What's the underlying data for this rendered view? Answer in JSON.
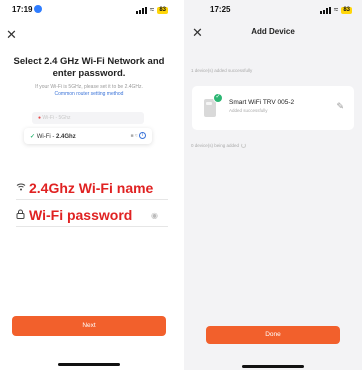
{
  "left_screen": {
    "status_bar": {
      "time": "17:19",
      "battery": "83"
    },
    "heading": "Select 2.4 GHz Wi-Fi Network and enter password.",
    "hint": "If your Wi-Fi is 5GHz, please set it to be 2.4GHz.",
    "hint_link": "Common router setting method",
    "illustration": {
      "row_5g": "Wi-Fi - 5Ghz",
      "row_24g_prefix": "Wi-Fi - ",
      "row_24g_band": "2.4Ghz"
    },
    "wifi_name_field": {
      "value": "2.4Ghz Wi-Fi name",
      "icon": "wifi-icon"
    },
    "password_field": {
      "value": "Wi-Fi password",
      "icon": "lock-icon"
    },
    "next_button": "Next",
    "colors": {
      "accent": "#f2602c",
      "annotation": "#e02222"
    }
  },
  "right_screen": {
    "status_bar": {
      "time": "17:25",
      "battery": "83"
    },
    "title": "Add Device",
    "added_label": "1 device(s) added successfully",
    "device": {
      "name": "Smart WiFi TRV 005-2",
      "status": "Added successfully"
    },
    "being_added_label": "0 device(s) being added",
    "done_button": "Done",
    "colors": {
      "success": "#2cb673"
    }
  }
}
